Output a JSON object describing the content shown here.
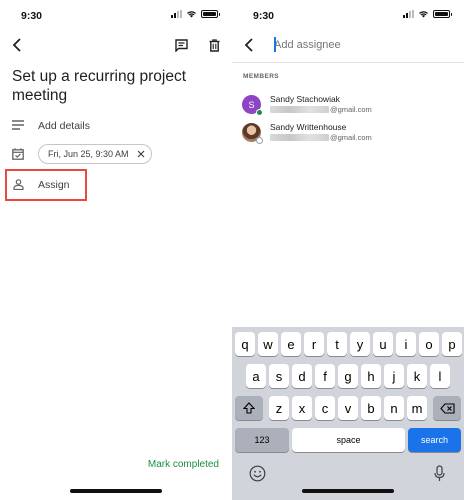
{
  "left_screen": {
    "status_time": "9:30",
    "title": "Set up a recurring project meeting",
    "add_details": "Add details",
    "date_chip": "Fri, Jun 25, 9:30 AM",
    "assign": "Assign",
    "mark_completed": "Mark completed",
    "highlight_color": "#ea4a3d"
  },
  "right_screen": {
    "status_time": "9:30",
    "search_placeholder": "Add assignee",
    "members_label": "MEMBERS",
    "members": [
      {
        "initial": "S",
        "name": "Sandy Stachowiak",
        "email_domain": "@gmail.com",
        "avatar_color": "#8e44c4"
      },
      {
        "initial": "",
        "name": "Sandy Writtenhouse",
        "email_domain": "@gmail.com",
        "avatar_color": "#7a5a48"
      }
    ],
    "keyboard": {
      "row1": [
        "q",
        "w",
        "e",
        "r",
        "t",
        "y",
        "u",
        "i",
        "o",
        "p"
      ],
      "row2": [
        "a",
        "s",
        "d",
        "f",
        "g",
        "h",
        "j",
        "k",
        "l"
      ],
      "row3": [
        "z",
        "x",
        "c",
        "v",
        "b",
        "n",
        "m"
      ],
      "numbers_key": "123",
      "space_key": "space",
      "search_key": "search"
    }
  },
  "colors": {
    "accent_blue": "#1a73e8",
    "complete_green": "#1e8e3e"
  }
}
